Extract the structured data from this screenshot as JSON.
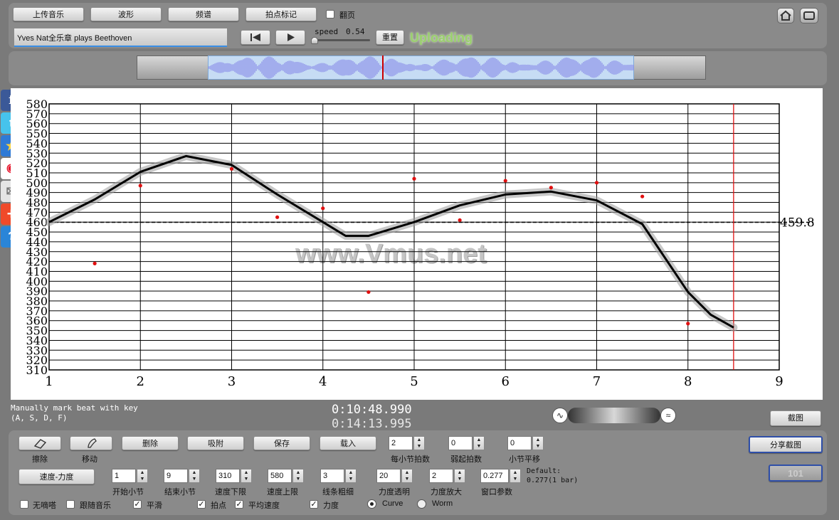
{
  "toolbar": {
    "upload_label": "上传音乐",
    "waveform_label": "波形",
    "spectrum_label": "频谱",
    "beatmark_label": "拍点标记",
    "pageflip_label": "翻页"
  },
  "player": {
    "track_title": "Yves Nat全乐章 plays Beethoven",
    "speed_label": "speed",
    "speed_value": "0.54",
    "reset_label": "重置",
    "status_text": "Uploading"
  },
  "watermark": "www.Vmus.net",
  "info": {
    "hint_line1": "Manually mark beat with key",
    "hint_line2": "(A, S, D, F)",
    "time_current": "0:10:48.990",
    "time_total": "0:14:13.995",
    "screenshot_label": "截图"
  },
  "controls": {
    "erase_label": "擦除",
    "move_label": "移动",
    "delete_label": "删除",
    "attach_label": "吸附",
    "save_label": "保存",
    "load_label": "载入",
    "beats_per_bar_label": "每小节拍数",
    "beats_per_bar_value": "2",
    "pickup_beats_label": "弱起拍数",
    "pickup_beats_value": "0",
    "bar_shift_label": "小节平移",
    "bar_shift_value": "0",
    "share_label": "分享截图",
    "tempo_dynamic_label": "速度-力度",
    "start_bar_label": "开始小节",
    "start_bar_value": "1",
    "end_bar_label": "结束小节",
    "end_bar_value": "9",
    "tempo_min_label": "速度下限",
    "tempo_min_value": "310",
    "tempo_max_label": "速度上限",
    "tempo_max_value": "580",
    "line_width_label": "线条粗细",
    "line_width_value": "3",
    "dyn_opacity_label": "力度透明",
    "dyn_opacity_value": "20",
    "dyn_scale_label": "力度放大",
    "dyn_scale_value": "2",
    "window_label": "窗口参数",
    "window_value": "0.277",
    "default_line1": "Default:",
    "default_line2": "0.277(1 bar)",
    "metronome_label": "无嘀嗒",
    "follow_label": "跟随音乐",
    "smooth_label": "平滑",
    "beats_label": "拍点",
    "avg_tempo_label": "平均速度",
    "dynamics_label": "力度",
    "curve_label": "Curve",
    "worm_label": "Worm"
  },
  "chart_data": {
    "type": "line",
    "xlim": [
      1,
      9
    ],
    "ylim": [
      310,
      580
    ],
    "x_ticks": [
      1,
      2,
      3,
      4,
      5,
      6,
      7,
      8,
      9
    ],
    "y_ticks": [
      310,
      320,
      330,
      340,
      350,
      360,
      370,
      380,
      390,
      400,
      410,
      420,
      430,
      440,
      450,
      460,
      470,
      480,
      490,
      500,
      510,
      520,
      530,
      540,
      550,
      560,
      570,
      580
    ],
    "average_tempo": 459.8,
    "average_label": "459.8",
    "cursor_x": 8.5,
    "curve": {
      "x": [
        1,
        1.5,
        2,
        2.5,
        3,
        3.5,
        4,
        4.25,
        4.5,
        5,
        5.5,
        6,
        6.5,
        7,
        7.5,
        8,
        8.25,
        8.5
      ],
      "y": [
        460,
        483,
        511,
        527,
        518,
        488,
        460,
        446,
        446,
        460,
        477,
        488,
        491,
        482,
        458,
        389,
        366,
        353
      ]
    },
    "beat_points": {
      "x": [
        1.5,
        2,
        3,
        3.5,
        4,
        4.5,
        5,
        5.5,
        6,
        6.5,
        7,
        7.5,
        8
      ],
      "y": [
        418,
        497,
        514,
        465,
        474,
        389,
        504,
        462,
        502,
        495,
        500,
        486,
        357
      ]
    }
  }
}
